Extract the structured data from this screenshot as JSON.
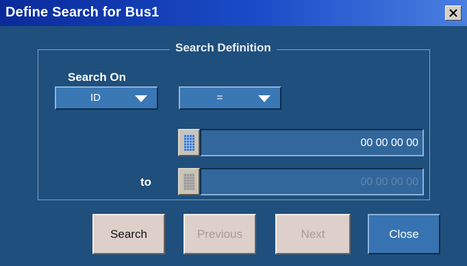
{
  "dialog": {
    "title": "Define Search for Bus1",
    "close_icon": "close-x-icon"
  },
  "group": {
    "title": "Search Definition"
  },
  "search_on": {
    "label": "Search On",
    "selected": "ID"
  },
  "operator": {
    "selected": "="
  },
  "value_from": {
    "value": "00 00 00 00",
    "keypad_icon": "keypad-icon"
  },
  "value_to": {
    "label": "to",
    "value": "00 00 00 00",
    "keypad_icon": "keypad-icon",
    "disabled": true
  },
  "buttons": {
    "search": "Search",
    "previous": "Previous",
    "next": "Next",
    "close": "Close"
  },
  "colors": {
    "dialog_bg": "#1f4f7c",
    "accent_blue": "#3a77b5",
    "title_bar": "#0a2a9a"
  }
}
